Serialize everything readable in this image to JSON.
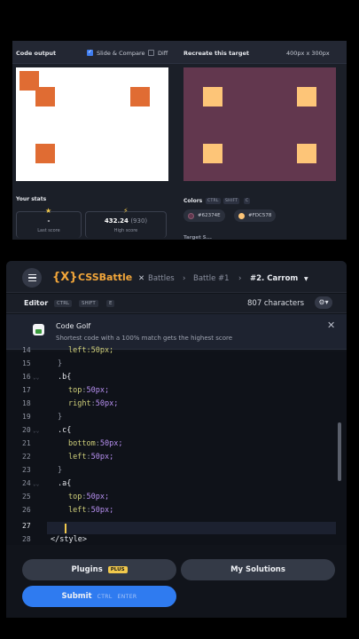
{
  "output": {
    "title": "Code output",
    "slide_compare_label": "Slide & Compare",
    "diff_label": "Diff"
  },
  "target": {
    "title": "Recreate this target",
    "size": "400px x 300px"
  },
  "stats": {
    "title": "Your stats",
    "last_score_value": "-",
    "last_score_label": "Last score",
    "high_score_value": "432.24",
    "high_score_extra": "(930)",
    "high_score_label": "High score"
  },
  "colors": {
    "title": "Colors",
    "kbd1": "CTRL",
    "kbd2": "SHIFT",
    "kbd3": "C",
    "swatches": [
      {
        "hex": "#62374E",
        "color": "#62374e"
      },
      {
        "hex": "#FDC578",
        "color": "#fdc578"
      }
    ],
    "obscured_label": "Target S..."
  },
  "header": {
    "logo_bracket": "{X}",
    "logo_text": "CSSBattle",
    "crumb_battles": "Battles",
    "crumb_battle": "Battle #1",
    "crumb_current": "#2. Carrom",
    "sep": "›"
  },
  "editor": {
    "label": "Editor",
    "kbd1": "CTRL",
    "kbd2": "SHIFT",
    "kbd3": "E",
    "char_count": "807 characters"
  },
  "notice": {
    "title": "Code Golf",
    "subtitle": "Shortest code with a 100% match gets the highest score"
  },
  "code": {
    "lines": [
      {
        "n": "14",
        "text": "left:50px;"
      },
      {
        "n": "15",
        "text": "}"
      },
      {
        "n": "16",
        "text": ".b{"
      },
      {
        "n": "17",
        "prop": "top",
        "val": "50px;"
      },
      {
        "n": "18",
        "prop": "right",
        "val": "50px;"
      },
      {
        "n": "19",
        "text": "}"
      },
      {
        "n": "20",
        "text": ".c{"
      },
      {
        "n": "21",
        "prop": "bottom",
        "val": "50px;"
      },
      {
        "n": "22",
        "prop": "left",
        "val": "50px;"
      },
      {
        "n": "23",
        "text": "}"
      },
      {
        "n": "24",
        "text": ".a{"
      },
      {
        "n": "25",
        "prop": "top",
        "val": "50px;"
      },
      {
        "n": "26",
        "prop": "left",
        "val": "50px;"
      },
      {
        "n": "27",
        "text": ""
      },
      {
        "n": "28",
        "text": "</style>"
      }
    ]
  },
  "buttons": {
    "plugins": "Plugins",
    "plugins_badge": "PLUS",
    "solutions": "My Solutions",
    "submit": "Submit",
    "submit_kbd1": "CTRL",
    "submit_kbd2": "ENTER"
  }
}
